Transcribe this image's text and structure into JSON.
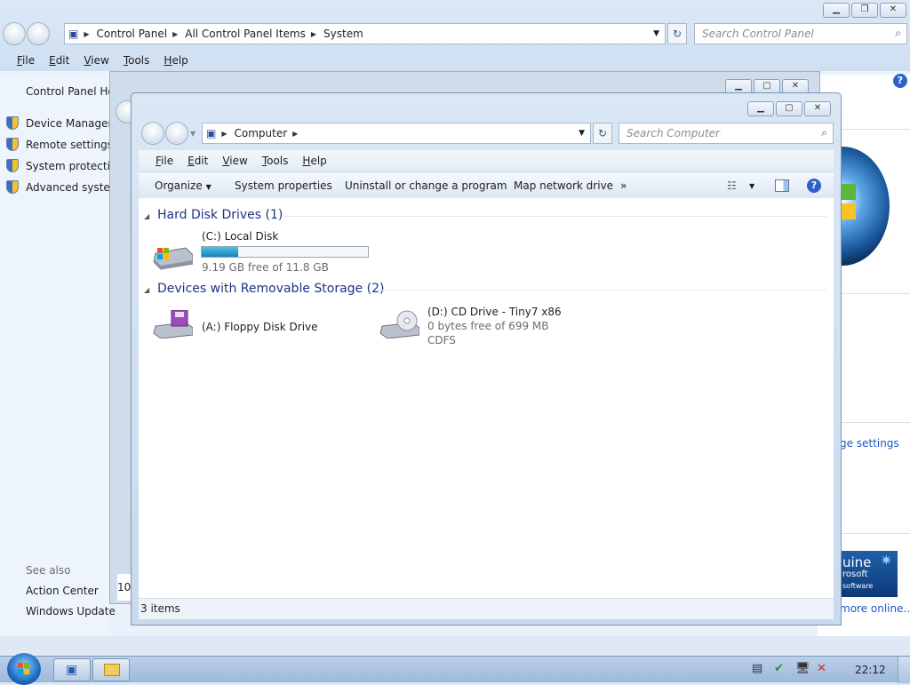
{
  "control_panel": {
    "breadcrumb": [
      "Control Panel",
      "All Control Panel Items",
      "System"
    ],
    "search_placeholder": "Search Control Panel",
    "menu": [
      "File",
      "Edit",
      "View",
      "Tools",
      "Help"
    ],
    "home_link": "Control Panel Ho",
    "tasks": [
      "Device Manager",
      "Remote settings",
      "System protectio",
      "Advanced system"
    ],
    "see_also_title": "See also",
    "see_also": [
      "Action Center",
      "Windows Update"
    ],
    "right_link": "ge settings",
    "more_online": "more online...",
    "genuine_lines": [
      "uine",
      "rosoft",
      "software"
    ],
    "mid_window_number": "10"
  },
  "computer_window": {
    "breadcrumb": [
      "Computer"
    ],
    "search_placeholder": "Search Computer",
    "menu": [
      "File",
      "Edit",
      "View",
      "Tools",
      "Help"
    ],
    "commands": [
      "Organize",
      "System properties",
      "Uninstall or change a program",
      "Map network drive",
      "»"
    ],
    "groups": [
      {
        "title": "Hard Disk Drives (1)",
        "items": [
          {
            "name": "(C:) Local Disk",
            "free_text": "9.19 GB free of 11.8 GB",
            "used_fraction": 0.22
          }
        ]
      },
      {
        "title": "Devices with Removable Storage (2)",
        "items": [
          {
            "name": "(A:) Floppy Disk Drive"
          },
          {
            "name": "(D:) CD Drive - Tiny7 x86",
            "free_text": "0 bytes free of 699 MB",
            "fs": "CDFS"
          }
        ]
      }
    ],
    "status": "3 items"
  },
  "taskbar": {
    "clock": "22:12"
  }
}
